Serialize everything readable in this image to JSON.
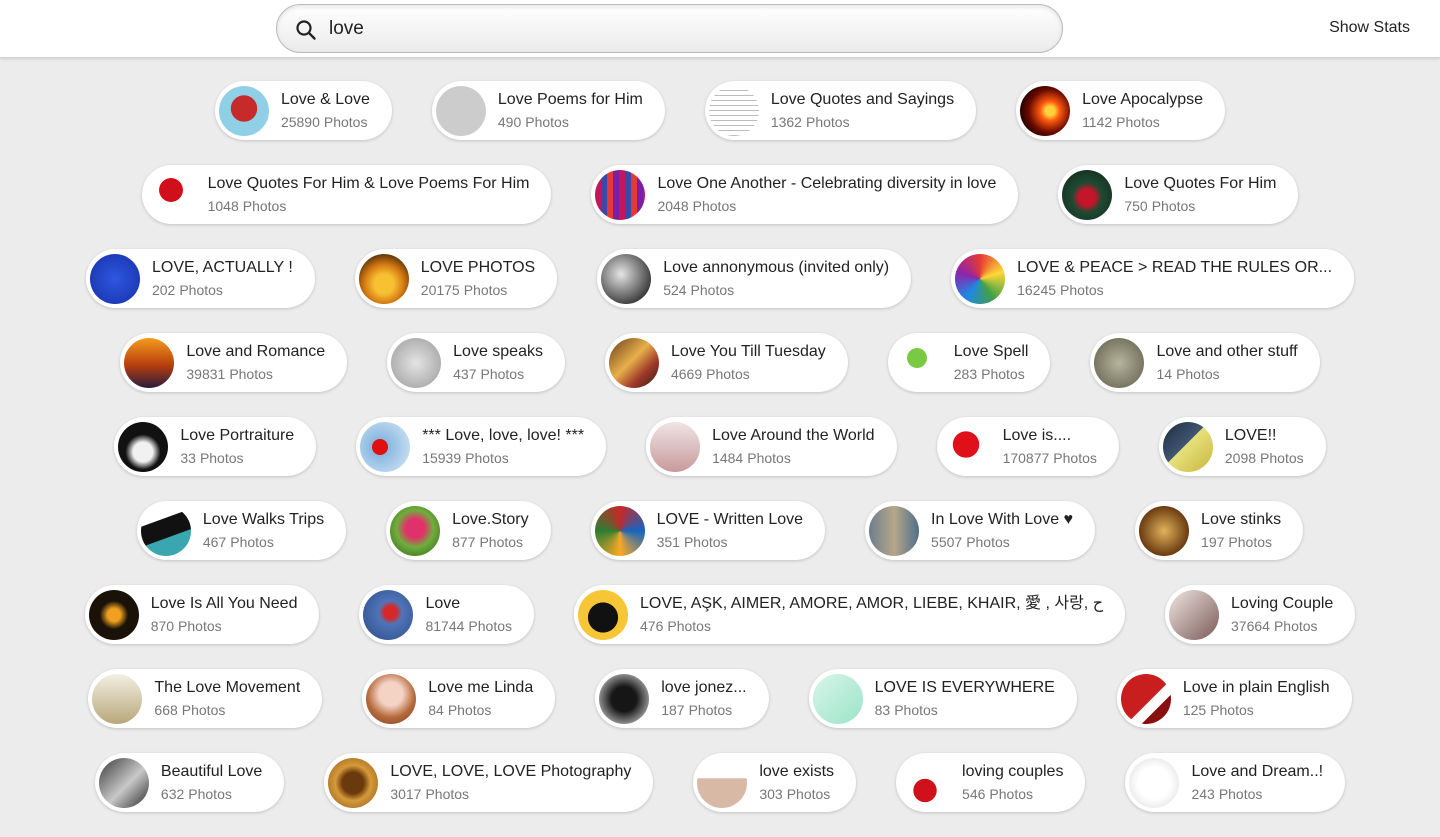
{
  "search": {
    "value": "love"
  },
  "header": {
    "show_stats": "Show Stats"
  },
  "photos_label": "Photos",
  "rows": [
    [
      {
        "name": "Love & Love",
        "count": "25890",
        "bg": "radial-gradient(circle at 50% 45%, #c62a2a 0 35%, #8fd0e6 36% 100%)"
      },
      {
        "name": "Love Poems for Him",
        "count": "490",
        "bg": "#cccccc"
      },
      {
        "name": "Love Quotes and Sayings",
        "count": "1362",
        "bg": "repeating-linear-gradient(#ffffff 0 4px, #bcbcbc 4px 5px)"
      },
      {
        "name": "Love Apocalypse",
        "count": "1142",
        "bg": "radial-gradient(circle at 60% 50%, #ffd23a 0 12%, #ff5a10 25%, #6a0a00 55%, #1a0000 80%)"
      }
    ],
    [
      {
        "name": "Love Quotes For Him & Love Poems For Him",
        "count": "1048",
        "bg": "radial-gradient(circle at 50% 40%, #d10f1b 0 30%, #ffffff 31%)"
      },
      {
        "name": "Love One Another - Celebrating diversity in love",
        "count": "2048",
        "bg": "repeating-linear-gradient(90deg, #c2185b 0 6px, #3949ab 6px 12px, #e53935 12px 18px, #7b1fa2 18px 24px)"
      },
      {
        "name": "Love Quotes For Him",
        "count": "750",
        "bg": "radial-gradient(circle at 50% 55%, #c5152a 0 22%, #1f4a32 40%, #0f2418 100%)"
      }
    ],
    [
      {
        "name": "LOVE, ACTUALLY !",
        "count": "202",
        "bg": "radial-gradient(circle at 50% 50%, #2f57e0, #1530a8)"
      },
      {
        "name": "LOVE PHOTOS",
        "count": "20175",
        "bg": "radial-gradient(circle at 50% 60%, #f7c132 0 25%, #d67a12 50%, #3a2208 85%)"
      },
      {
        "name": "Love annonymous (invited only)",
        "count": "524",
        "bg": "radial-gradient(circle at 40% 40%, #e6e6e6, #3a3a3a 75%)"
      },
      {
        "name": "LOVE & PEACE > READ THE RULES OR...",
        "count": "16245",
        "bg": "conic-gradient(#e53935, #fdd835, #43a047, #1e88e5, #8e24aa, #e53935)"
      }
    ],
    [
      {
        "name": "Love and Romance",
        "count": "39831",
        "bg": "linear-gradient(#f59b1e, #b53d0e 55%, #2a1c3e)"
      },
      {
        "name": "Love speaks",
        "count": "437",
        "bg": "radial-gradient(circle at 50% 50%, #e4e4e4, #9a9a9a)"
      },
      {
        "name": "Love You Till Tuesday",
        "count": "4669",
        "bg": "linear-gradient(135deg, #6b3b1e, #e7b04a 45%, #a13a2a 70%, #2b1a14)"
      },
      {
        "name": "Love Spell",
        "count": "283",
        "bg": "radial-gradient(circle at 50% 40%, #7ac943 0 25%, #ffffff 26%)"
      },
      {
        "name": "Love and other stuff",
        "count": "14",
        "bg": "radial-gradient(circle at 50% 50%, #b7b59c, #5e5b48)"
      }
    ],
    [
      {
        "name": "Love Portraiture",
        "count": "33",
        "bg": "radial-gradient(circle at 50% 60%, #f1f1f1 0 25%, #111111 45%)"
      },
      {
        "name": "*** Love, love, love! ***",
        "count": "15939",
        "bg": "radial-gradient(circle at 40% 50%, #e01010 0 20%, #8ab8e0 21%, #d8e9f7)"
      },
      {
        "name": "Love Around the World",
        "count": "1484",
        "bg": "linear-gradient(#f0e4e4, #c89a9a)"
      },
      {
        "name": "Love is....",
        "count": "170877",
        "bg": "radial-gradient(circle at 50% 45%, #e0101a 0 35%, #ffffff 36%)"
      },
      {
        "name": "LOVE!!",
        "count": "2098",
        "bg": "linear-gradient(135deg, #1d2b3c, #3f5671 45%, #e7e07a 46%, #c6b640)"
      }
    ],
    [
      {
        "name": "Love Walks Trips",
        "count": "467",
        "bg": "linear-gradient(160deg, #ffffff 0 30%, #111111 31% 60%, #3aa6b0 61%)"
      },
      {
        "name": "Love.Story",
        "count": "877",
        "bg": "radial-gradient(circle at 50% 45%, #e0316a 0 25%, #6fae3c 50%, #2f5e1b)"
      },
      {
        "name": "LOVE - Written Love",
        "count": "351",
        "bg": "conic-gradient(#c62828, #1565c0, #f9a825, #2e7d32, #c62828)"
      },
      {
        "name": "In Love With Love ♥",
        "count": "5507",
        "bg": "linear-gradient(90deg, #6b7d8d, #b7a78a 50%, #4f6f8a)"
      },
      {
        "name": "Love stinks",
        "count": "197",
        "bg": "radial-gradient(circle at 50% 50%, #e2b35a, #6a3b10 70%)"
      }
    ],
    [
      {
        "name": "Love Is All You Need",
        "count": "870",
        "bg": "radial-gradient(circle at 50% 50%, #f0a020 0 18%, #1a1208 40%)"
      },
      {
        "name": "Love",
        "count": "81744",
        "bg": "radial-gradient(circle at 55% 45%, #d62828 0 16%, #4f74b8 30%, #2c4a86)"
      },
      {
        "name": "LOVE, AŞK, AIMER, AMORE, AMOR, LIEBE, KHAIR, 愛 , 사랑, ح",
        "count": "476",
        "bg": "radial-gradient(circle at 50% 55%, #111111 0 40%, #f6c637 41%)"
      },
      {
        "name": "Loving Couple",
        "count": "37664",
        "bg": "linear-gradient(135deg, #efe6e2, #7a5a56)"
      }
    ],
    [
      {
        "name": "The Love Movement",
        "count": "668",
        "bg": "linear-gradient(#f2efe3, #b8a77a)"
      },
      {
        "name": "Love me Linda",
        "count": "84",
        "bg": "radial-gradient(circle at 50% 40%, #f4d2c4 0 30%, #b66a3c 60%, #7a3b22)"
      },
      {
        "name": "love jonez...",
        "count": "187",
        "bg": "radial-gradient(circle at 50% 50%, #161616 0 35%, #8c8c8c 70%, #303030)"
      },
      {
        "name": "LOVE IS EVERYWHERE",
        "count": "83",
        "bg": "linear-gradient(135deg, #d8f5ea, #9be4c8)"
      },
      {
        "name": "Love in plain English",
        "count": "125",
        "bg": "linear-gradient(135deg, #c81e1e 0 55%, #ffffff 56% 70%, #8a1010 71%)"
      }
    ],
    [
      {
        "name": "Beautiful Love",
        "count": "632",
        "bg": "linear-gradient(135deg, #3a3a3a, #c8c8c8 55%, #2a2a2a)"
      },
      {
        "name": "LOVE, LOVE, LOVE Photography",
        "count": "3017",
        "bg": "radial-gradient(circle at 50% 50%, #6a3a0c 0 30%, #d69a3a 50%, #8a5416)"
      },
      {
        "name": "love exists",
        "count": "303",
        "bg": "linear-gradient(#ffffff 0 40%, #d7b9a6 41%)"
      },
      {
        "name": "loving couples",
        "count": "546",
        "bg": "radial-gradient(circle at 50% 65%, #d0101a 0 28%, #ffffff 29%)"
      },
      {
        "name": "Love and Dream..!",
        "count": "243",
        "bg": "radial-gradient(circle at 50% 50%, #ffffff 0 45%, #d8d8d8)"
      }
    ]
  ]
}
